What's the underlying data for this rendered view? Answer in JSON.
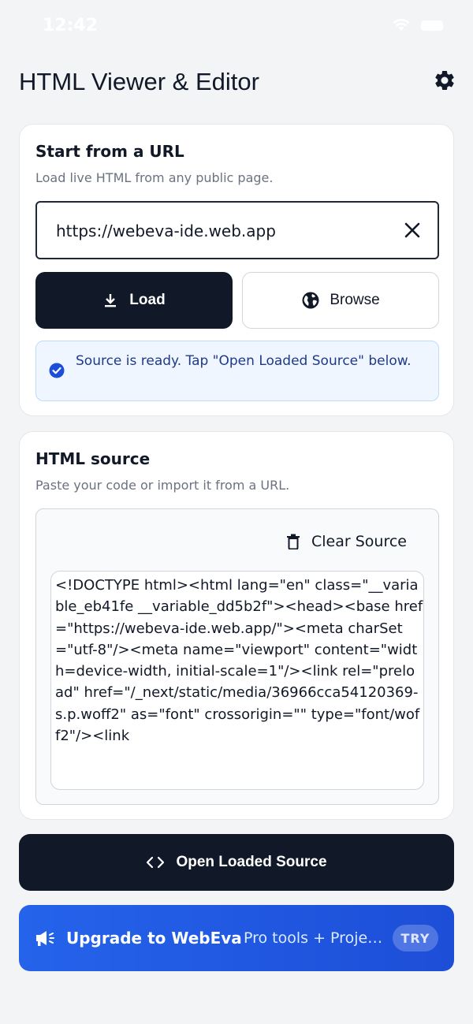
{
  "status_bar": {
    "time": "12:42"
  },
  "header": {
    "title": "HTML Viewer & Editor"
  },
  "url_card": {
    "title": "Start from a URL",
    "subtitle": "Load live HTML from any public page.",
    "url_value": "https://webeva-ide.web.app",
    "load_label": "Load",
    "browse_label": "Browse",
    "ready_message": "Source is ready. Tap \"Open Loaded Source\" below."
  },
  "source_card": {
    "title": "HTML source",
    "subtitle": "Paste your code or import it from a URL.",
    "clear_label": "Clear Source",
    "source_text": "<!DOCTYPE html><html lang=\"en\" class=\"__variable_eb41fe __variable_dd5b2f\"><head><base href=\"https://webeva-ide.web.app/\"><meta charSet=\"utf-8\"/><meta name=\"viewport\" content=\"width=device-width, initial-scale=1\"/><link rel=\"preload\" href=\"/_next/static/media/36966cca54120369-s.p.woff2\" as=\"font\" crossorigin=\"\" type=\"font/woff2\"/><link"
  },
  "open_button": {
    "label": "Open Loaded Source"
  },
  "upgrade": {
    "title": "Upgrade to WebEva",
    "subtitle": "Pro tools + Projects",
    "badge": "TRY"
  },
  "icons": {
    "settings": "gear-icon",
    "clear_url": "close-icon",
    "load": "download-icon",
    "browse": "globe-icon",
    "ready": "check-circle-icon",
    "clear_source": "trash-icon",
    "open": "code-icon",
    "upgrade": "megaphone-icon"
  },
  "colors": {
    "primary_dark": "#111827",
    "info_bg": "#eff6ff",
    "info_text": "#1e3a8a",
    "accent_blue": "#2563eb"
  }
}
